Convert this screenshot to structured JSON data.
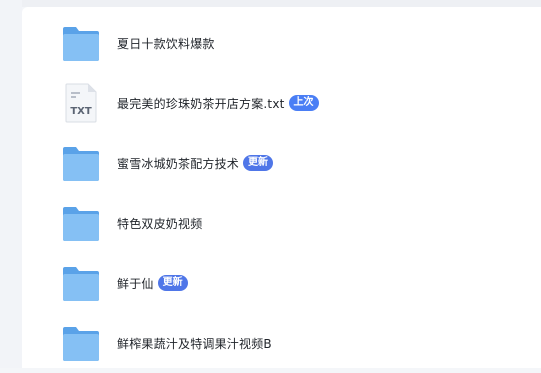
{
  "colors": {
    "folder_back": "#5aa2e8",
    "folder_front": "#85c0f4",
    "badge_last": "#4a7ef5",
    "badge_updated": "#4f76e8",
    "txt_label": "#5b6473"
  },
  "files": [
    {
      "name": "夏日十款饮料爆款",
      "type": "folder-icon",
      "badge": null
    },
    {
      "name": "最完美的珍珠奶茶开店方案.txt",
      "type": "txt-file-icon",
      "badge": "上次",
      "badge_kind": "last"
    },
    {
      "name": "蜜雪冰城奶茶配方技术",
      "type": "folder-icon",
      "badge": "更新",
      "badge_kind": "updated"
    },
    {
      "name": "特色双皮奶视频",
      "type": "folder-icon",
      "badge": null
    },
    {
      "name": "鲜于仙",
      "type": "folder-icon",
      "badge": "更新",
      "badge_kind": "updated"
    },
    {
      "name": "鲜榨果蔬汁及特调果汁视频B",
      "type": "folder-icon",
      "badge": null
    }
  ],
  "txt_icon_label": "TXT"
}
